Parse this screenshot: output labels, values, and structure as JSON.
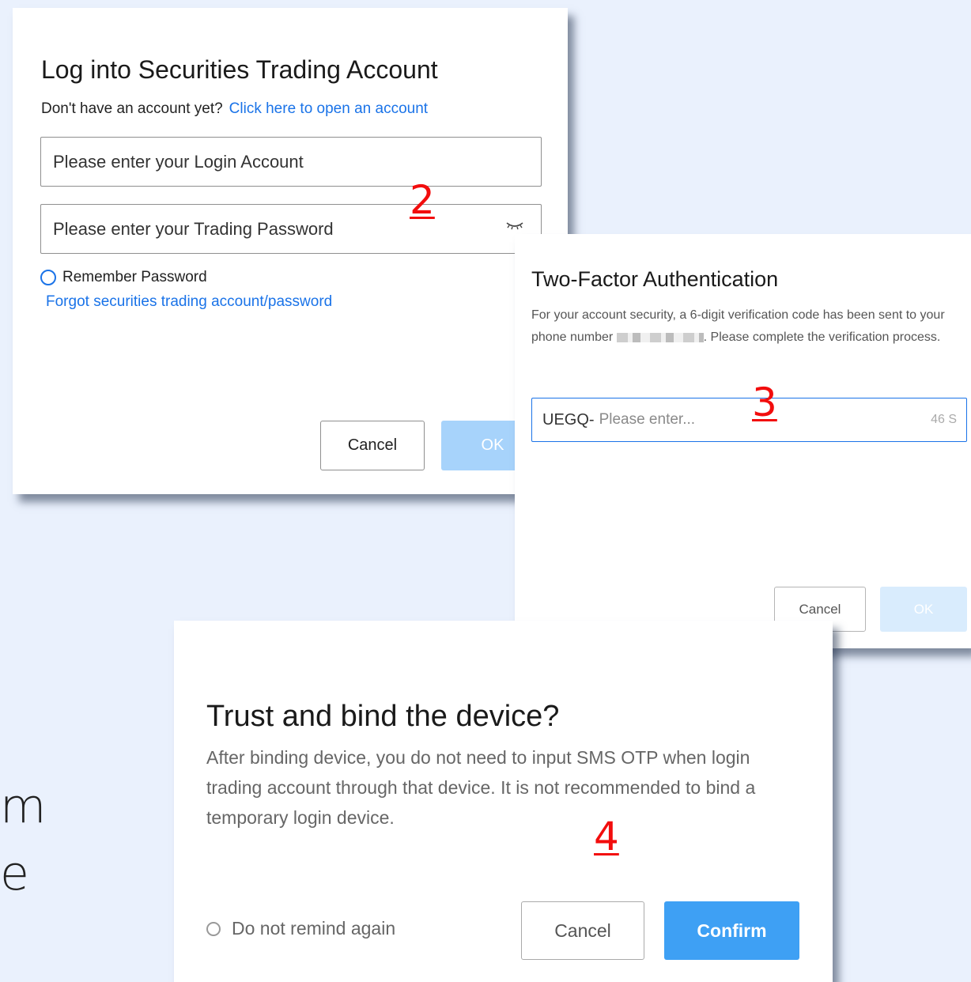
{
  "background_text": {
    "line1": "m",
    "line2": "e"
  },
  "login_dialog": {
    "title": "Log into Securities Trading Account",
    "no_account_text": "Don't have an account yet?",
    "open_account_link": "Click here to open an account",
    "login_account_placeholder": "Please enter your Login Account",
    "password_placeholder": "Please enter your Trading Password",
    "remember_label": "Remember Password",
    "forgot_link": "Forgot securities trading account/password",
    "cancel_label": "Cancel",
    "ok_label": "OK",
    "step_label": "2"
  },
  "two_factor_dialog": {
    "title": "Two-Factor Authentication",
    "desc_part1": "For your account security, a 6-digit verification code has been sent to your phone number",
    "desc_part2": ". Please complete the verification process.",
    "code_prefix": "UEGQ-",
    "code_placeholder": "Please enter...",
    "timer": "46 S",
    "cancel_label": "Cancel",
    "ok_label": "OK",
    "step_label": "3"
  },
  "bind_dialog": {
    "title": "Trust and bind the device?",
    "description": "After binding device, you do not need to input SMS OTP when login trading account through that device. It is not recommended to bind a temporary login device.",
    "remind_label": "Do not remind again",
    "cancel_label": "Cancel",
    "confirm_label": "Confirm",
    "step_label": "4"
  },
  "colors": {
    "background": "#eaf1fd",
    "link": "#1a73e8",
    "primary_button": "#3ea0f4",
    "disabled_button": "#a7d3fb",
    "step_marker": "#f20d0d"
  }
}
